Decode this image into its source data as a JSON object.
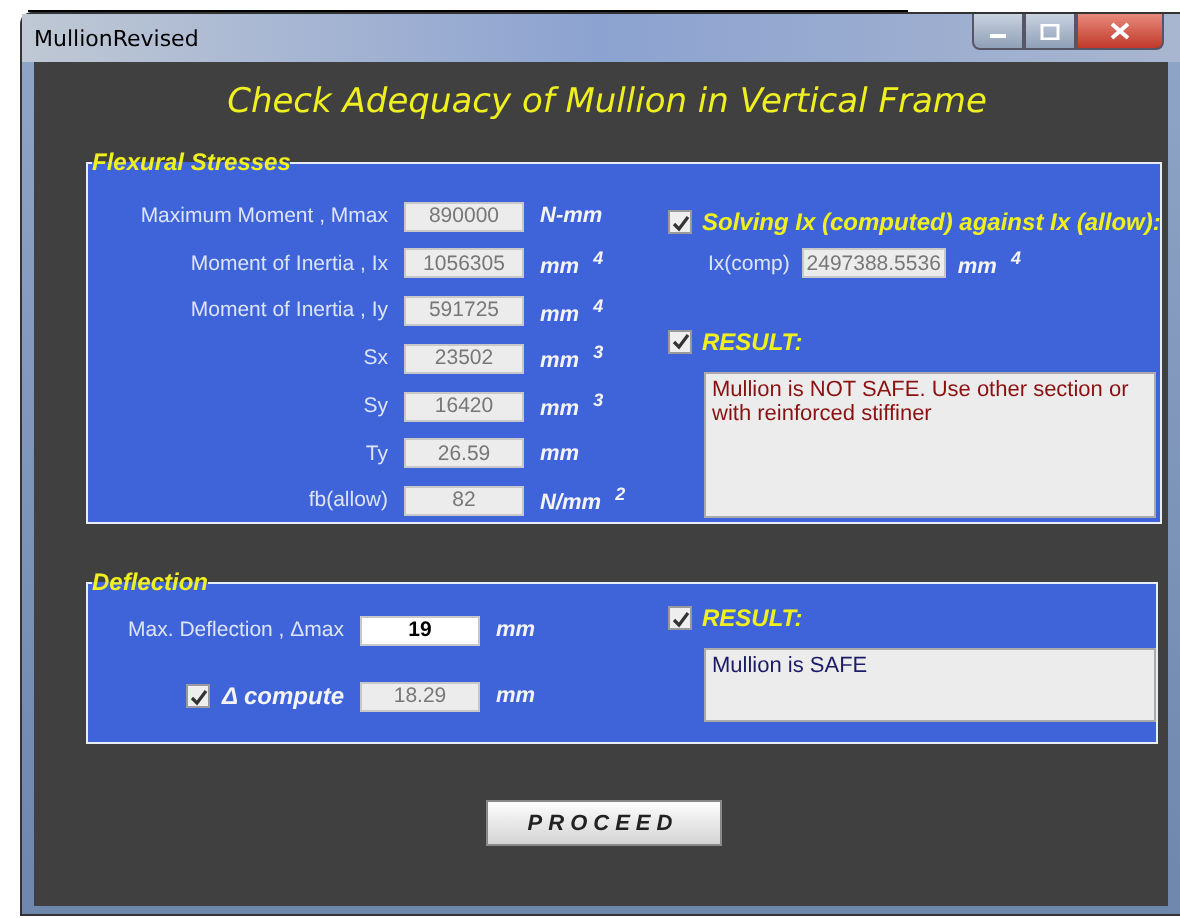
{
  "window": {
    "title": "MullionRevised"
  },
  "heading": "Check Adequacy of Mullion in Vertical Frame",
  "flexural": {
    "title": "Flexural Stresses",
    "fields": [
      {
        "label": "Maximum Moment , Mmax",
        "value": "890000",
        "unit": "N-mm",
        "editable": false
      },
      {
        "label": "Moment of Inertia , Ix",
        "value": "1056305",
        "unit": "mm $^{4}$",
        "editable": false
      },
      {
        "label": "Moment of Inertia , Iy",
        "value": "591725",
        "unit": "mm $^{4}$",
        "editable": false
      },
      {
        "label": "Sx",
        "value": "23502",
        "unit": "mm $^{3}$",
        "editable": false
      },
      {
        "label": "Sy",
        "value": "16420",
        "unit": "mm $^{3}$",
        "editable": false
      },
      {
        "label": "Ty",
        "value": "26.59",
        "unit": "mm",
        "editable": false
      },
      {
        "label": "fb(allow)",
        "value": "82",
        "unit": "N/mm $^{2}$",
        "editable": false
      }
    ],
    "solving": {
      "label": "Solving  Ix (computed) against Ix (allow):",
      "checked": true,
      "field_label": "Ix(comp)",
      "value": "2497388.5536",
      "unit": "mm $^{4}$"
    },
    "result": {
      "label": "RESULT:",
      "checked": true,
      "text": "Mullion is NOT SAFE. Use other section or with reinforced stiffiner",
      "safe": false
    }
  },
  "deflection": {
    "title": "Deflection",
    "max": {
      "label": "Max. Deflection , Δmax",
      "value": "19",
      "unit": "mm",
      "editable": true
    },
    "compute": {
      "label": "Δ compute",
      "checked": true,
      "value": "18.29",
      "unit": "mm",
      "editable": false
    },
    "result": {
      "label": "RESULT:",
      "checked": true,
      "text": "Mullion is SAFE",
      "safe": true
    }
  },
  "buttons": [
    {
      "label": "PROCEED"
    }
  ]
}
